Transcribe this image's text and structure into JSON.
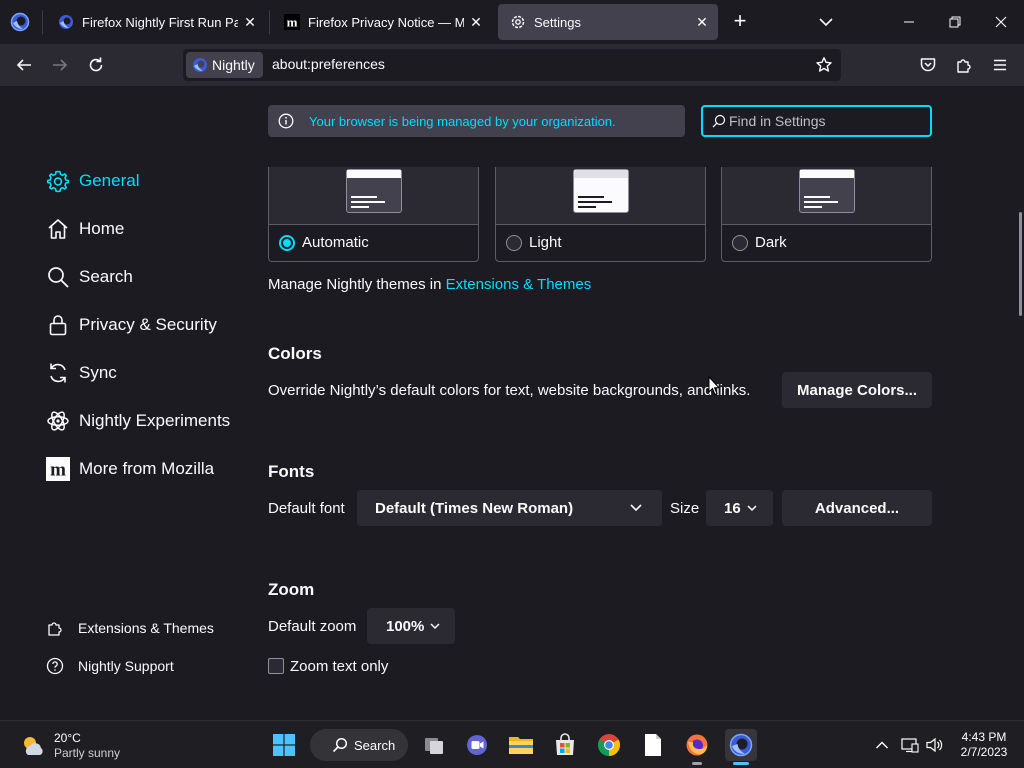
{
  "tabs": [
    {
      "title": "Firefox Nightly First Run Page",
      "favicon": "nightly-icon",
      "active": false
    },
    {
      "title": "Firefox Privacy Notice — Mozill",
      "favicon": "mozilla-m-icon",
      "active": false
    },
    {
      "title": "Settings",
      "favicon": "gear-icon",
      "active": true
    }
  ],
  "navbar": {
    "identity_label": "Nightly",
    "url": "about:preferences"
  },
  "policy_banner": "Your browser is being managed by your organization.",
  "search": {
    "placeholder": "Find in Settings"
  },
  "sidebar": {
    "items": [
      {
        "label": "General",
        "icon": "gear-icon",
        "selected": true
      },
      {
        "label": "Home",
        "icon": "home-icon",
        "selected": false
      },
      {
        "label": "Search",
        "icon": "search-icon",
        "selected": false
      },
      {
        "label": "Privacy & Security",
        "icon": "lock-icon",
        "selected": false
      },
      {
        "label": "Sync",
        "icon": "sync-icon",
        "selected": false
      },
      {
        "label": "Nightly Experiments",
        "icon": "atom-icon",
        "selected": false
      },
      {
        "label": "More from Mozilla",
        "icon": "mozilla-m-icon",
        "selected": false
      }
    ],
    "footer": [
      {
        "label": "Extensions & Themes",
        "icon": "puzzle-icon"
      },
      {
        "label": "Nightly Support",
        "icon": "help-icon"
      }
    ]
  },
  "themes": {
    "options": [
      {
        "label": "Automatic",
        "checked": true
      },
      {
        "label": "Light",
        "checked": false
      },
      {
        "label": "Dark",
        "checked": false
      }
    ],
    "manage_text": "Manage Nightly themes in",
    "manage_link": "Extensions & Themes"
  },
  "colors": {
    "heading": "Colors",
    "description": "Override Nightly’s default colors for text, website backgrounds, and links.",
    "button": "Manage Colors..."
  },
  "fonts": {
    "heading": "Fonts",
    "default_font_label": "Default font",
    "default_font_value": "Default (Times New Roman)",
    "size_label": "Size",
    "size_value": "16",
    "advanced_button": "Advanced..."
  },
  "zoom": {
    "heading": "Zoom",
    "default_zoom_label": "Default zoom",
    "default_zoom_value": "100%",
    "text_only_label": "Zoom text only",
    "text_only_checked": false
  },
  "taskbar": {
    "weather_temp": "20°C",
    "weather_desc": "Partly sunny",
    "search_label": "Search",
    "time": "4:43 PM",
    "date": "2/7/2023"
  },
  "colors_theme": {
    "accent": "#00ddff",
    "background": "#1c1b22",
    "surface": "#2b2a33",
    "surface_raised": "#42414d",
    "text": "#fbfbfe"
  }
}
